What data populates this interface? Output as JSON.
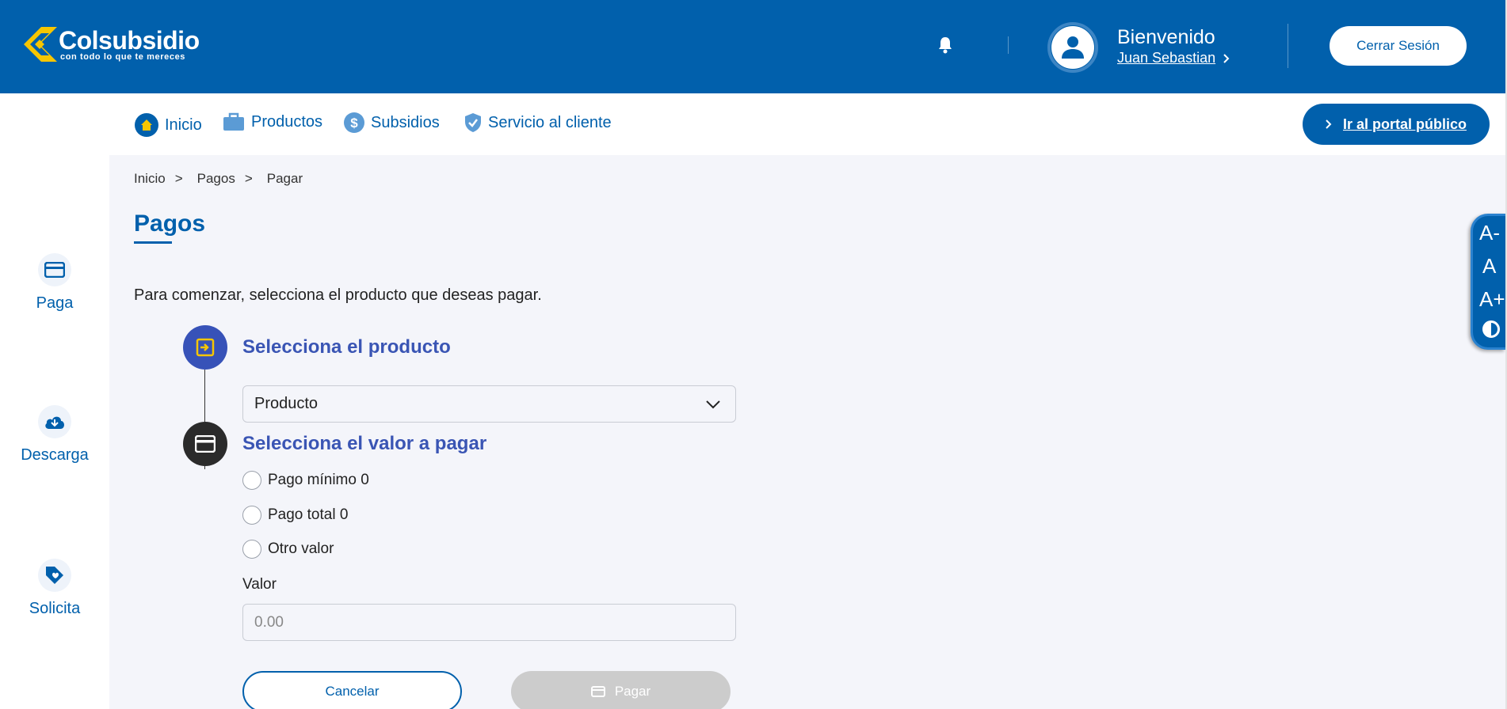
{
  "header": {
    "logo_name": "Colsubsidio",
    "logo_tagline": "con todo lo que te mereces",
    "welcome": "Bienvenido",
    "user_name": "Juan Sebastian",
    "logout_label": "Cerrar Sesión",
    "icons": [
      "bell-icon",
      "user-avatar-icon",
      "chevron-right-icon"
    ]
  },
  "topnav": {
    "items": [
      {
        "label": "Inicio",
        "icon": "home-icon"
      },
      {
        "label": "Productos",
        "icon": "briefcase-icon"
      },
      {
        "label": "Subsidios",
        "icon": "dollar-icon"
      },
      {
        "label": "Servicio al cliente",
        "icon": "shield-check-icon"
      }
    ],
    "portal_label": "Ir al portal público"
  },
  "sidebar": {
    "items": [
      {
        "label": "Paga",
        "icon": "credit-card-icon"
      },
      {
        "label": "Descarga",
        "icon": "cloud-download-icon"
      },
      {
        "label": "Solicita",
        "icon": "tag-heart-icon"
      }
    ]
  },
  "main": {
    "breadcrumb": [
      "Inicio",
      "Pagos",
      "Pagar"
    ],
    "breadcrumb_sep": ">",
    "title": "Pagos",
    "intro": "Para comenzar, selecciona el producto que deseas pagar.",
    "step1": {
      "title": "Selecciona el producto",
      "select_value": "Producto"
    },
    "step2": {
      "title": "Selecciona el valor a pagar",
      "options": [
        "Pago mínimo 0",
        "Pago total 0",
        "Otro valor"
      ]
    },
    "valor_label": "Valor",
    "valor_placeholder": "0.00",
    "cancel_label": "Cancelar",
    "pay_label": "Pagar"
  },
  "a11y": {
    "decrease": "A-",
    "normal": "A",
    "increase": "A+"
  },
  "colors": {
    "primary": "#0160ac",
    "step_active": "#3752b8",
    "step_inactive": "#2b2b2b",
    "logo_yellow": "#f7c600",
    "background": "#f4f5fa"
  }
}
